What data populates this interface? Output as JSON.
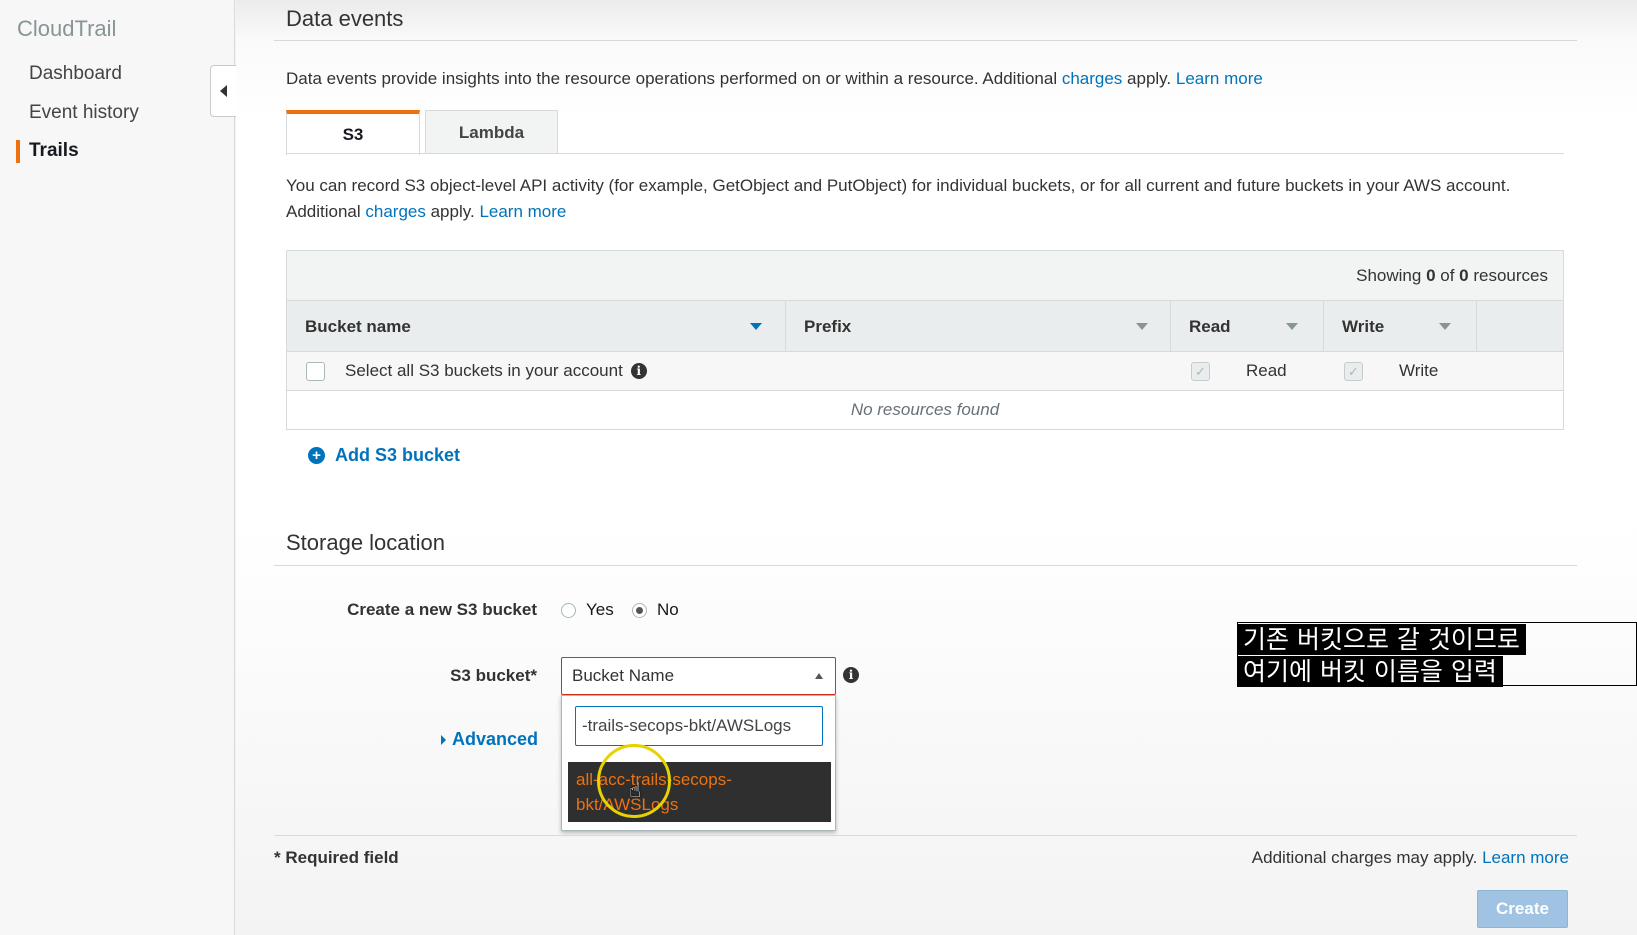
{
  "sidebar": {
    "title": "CloudTrail",
    "items": [
      {
        "label": "Dashboard"
      },
      {
        "label": "Event history"
      },
      {
        "label": "Trails"
      }
    ]
  },
  "data_events": {
    "title": "Data events",
    "desc_prefix": "Data events provide insights into the resource operations performed on or within a resource. Additional ",
    "charges_link": "charges",
    "desc_mid": " apply. ",
    "learn_more": "Learn more",
    "tabs": [
      {
        "label": "S3"
      },
      {
        "label": "Lambda"
      }
    ],
    "s3_desc_line1": "You can record S3 object-level API activity (for example, GetObject and PutObject) for individual buckets, or for all current and future buckets in your AWS account.",
    "s3_desc_line2_prefix": "Additional ",
    "s3_desc_line2_link": "charges",
    "s3_desc_line2_mid": " apply. ",
    "s3_desc_line2_learn": "Learn more"
  },
  "table": {
    "showing_prefix": "Showing ",
    "showing_count": "0",
    "showing_of": " of ",
    "showing_total": "0",
    "showing_suffix": " resources",
    "columns": [
      {
        "label": "Bucket name"
      },
      {
        "label": "Prefix"
      },
      {
        "label": "Read"
      },
      {
        "label": "Write"
      }
    ],
    "select_all_label": "Select all S3 buckets in your account",
    "read_label": "Read",
    "write_label": "Write",
    "empty_text": "No resources found",
    "add_bucket_label": "Add S3 bucket"
  },
  "storage": {
    "title": "Storage location",
    "create_new_label": "Create a new S3 bucket",
    "yes_label": "Yes",
    "no_label": "No",
    "selected": "No",
    "bucket_label": "S3 bucket*",
    "bucket_select_value": "Bucket Name",
    "search_value": "-trails-secops-bkt/AWSLogs",
    "option_line1": "all-acc-trails-secops-",
    "option_line2": "bkt/AWSLogs",
    "advanced_label": "Advanced"
  },
  "caption": {
    "line1": "기존 버킷으로 갈 것이므로",
    "line2": "여기에 버킷 이름을 입력"
  },
  "footer": {
    "required": "* Required field",
    "charges_note": "Additional charges may apply. ",
    "learn_more": "Learn more",
    "create_label": "Create"
  },
  "colors": {
    "accent": "#ec7211",
    "link": "#0073bb",
    "error_border": "#d13212"
  }
}
